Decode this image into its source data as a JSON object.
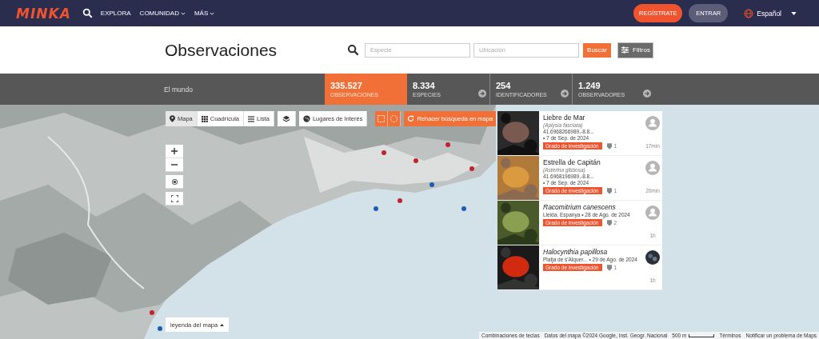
{
  "nav": {
    "logo": "MINKA",
    "links": [
      {
        "label": "EXPLORA",
        "dropdown": false
      },
      {
        "label": "COMUNIDAD",
        "dropdown": true
      },
      {
        "label": "MÁS",
        "dropdown": true
      }
    ],
    "signup": "REGÍSTRATE",
    "login": "ENTRAR",
    "language": "Español"
  },
  "header": {
    "title": "Observaciones",
    "species_field": {
      "placeholder": "Especie"
    },
    "location_field": {
      "placeholder": "Ubicación"
    },
    "search_button": "Buscar",
    "filters_button": "Filtros"
  },
  "stats": {
    "place": "El mundo",
    "items": [
      {
        "value": "335.527",
        "label": "OBSERVACIONES",
        "selected": true
      },
      {
        "value": "8.334",
        "label": "ESPECIES",
        "selected": false
      },
      {
        "value": "254",
        "label": "IDENTIFICADORES",
        "selected": false
      },
      {
        "value": "1.249",
        "label": "OBSERVADORES",
        "selected": false
      }
    ]
  },
  "map": {
    "views": [
      {
        "label": "Mapa",
        "selected": true
      },
      {
        "label": "Cuadrícula",
        "selected": false
      },
      {
        "label": "Lista",
        "selected": false
      }
    ],
    "places_button": "Lugares de Interés",
    "redo_button": "Rehacer búsqueda en mapa",
    "legend_button": "leyenda del mapa",
    "attribution": [
      "Combinaciones de teclas",
      "Datos del mapa ©2024 Google, Inst. Geogr. Nacional",
      "500 m",
      "Términos",
      "Notificar un problema de Maps"
    ]
  },
  "observations": [
    {
      "name": "Liebre de Mar",
      "kind": "common",
      "scientific": "(Aplysia fasciata)",
      "place": "41.6968266989,-8.8...",
      "date": "• 7 de Sep. de 2024",
      "quality": "Grado de investigación",
      "ids": "1",
      "time": "17min",
      "photo_avatar": false
    },
    {
      "name": "Estrella de Capitán",
      "kind": "common",
      "scientific": "(Asterina gibbosa)",
      "place": "41.6968196989,-8.8...",
      "date": "• 7 de Sep. de 2024",
      "quality": "Grado de investigación",
      "ids": "1",
      "time": "20min",
      "photo_avatar": false
    },
    {
      "name": "Racomitrium canescens",
      "kind": "scientific",
      "place": "Lleida, Espanya",
      "date": "• 28 de Ago. de 2024",
      "quality": "Grado de investigación",
      "ids": "2",
      "time": "1h",
      "photo_avatar": false
    },
    {
      "name": "Halocynthia papillosa",
      "kind": "scientific",
      "place": "Platja de s'Alquer...",
      "date": "• 29 de Ago. de 2024",
      "quality": "Grado de investigación",
      "ids": "1",
      "time": "1h",
      "photo_avatar": true
    }
  ]
}
